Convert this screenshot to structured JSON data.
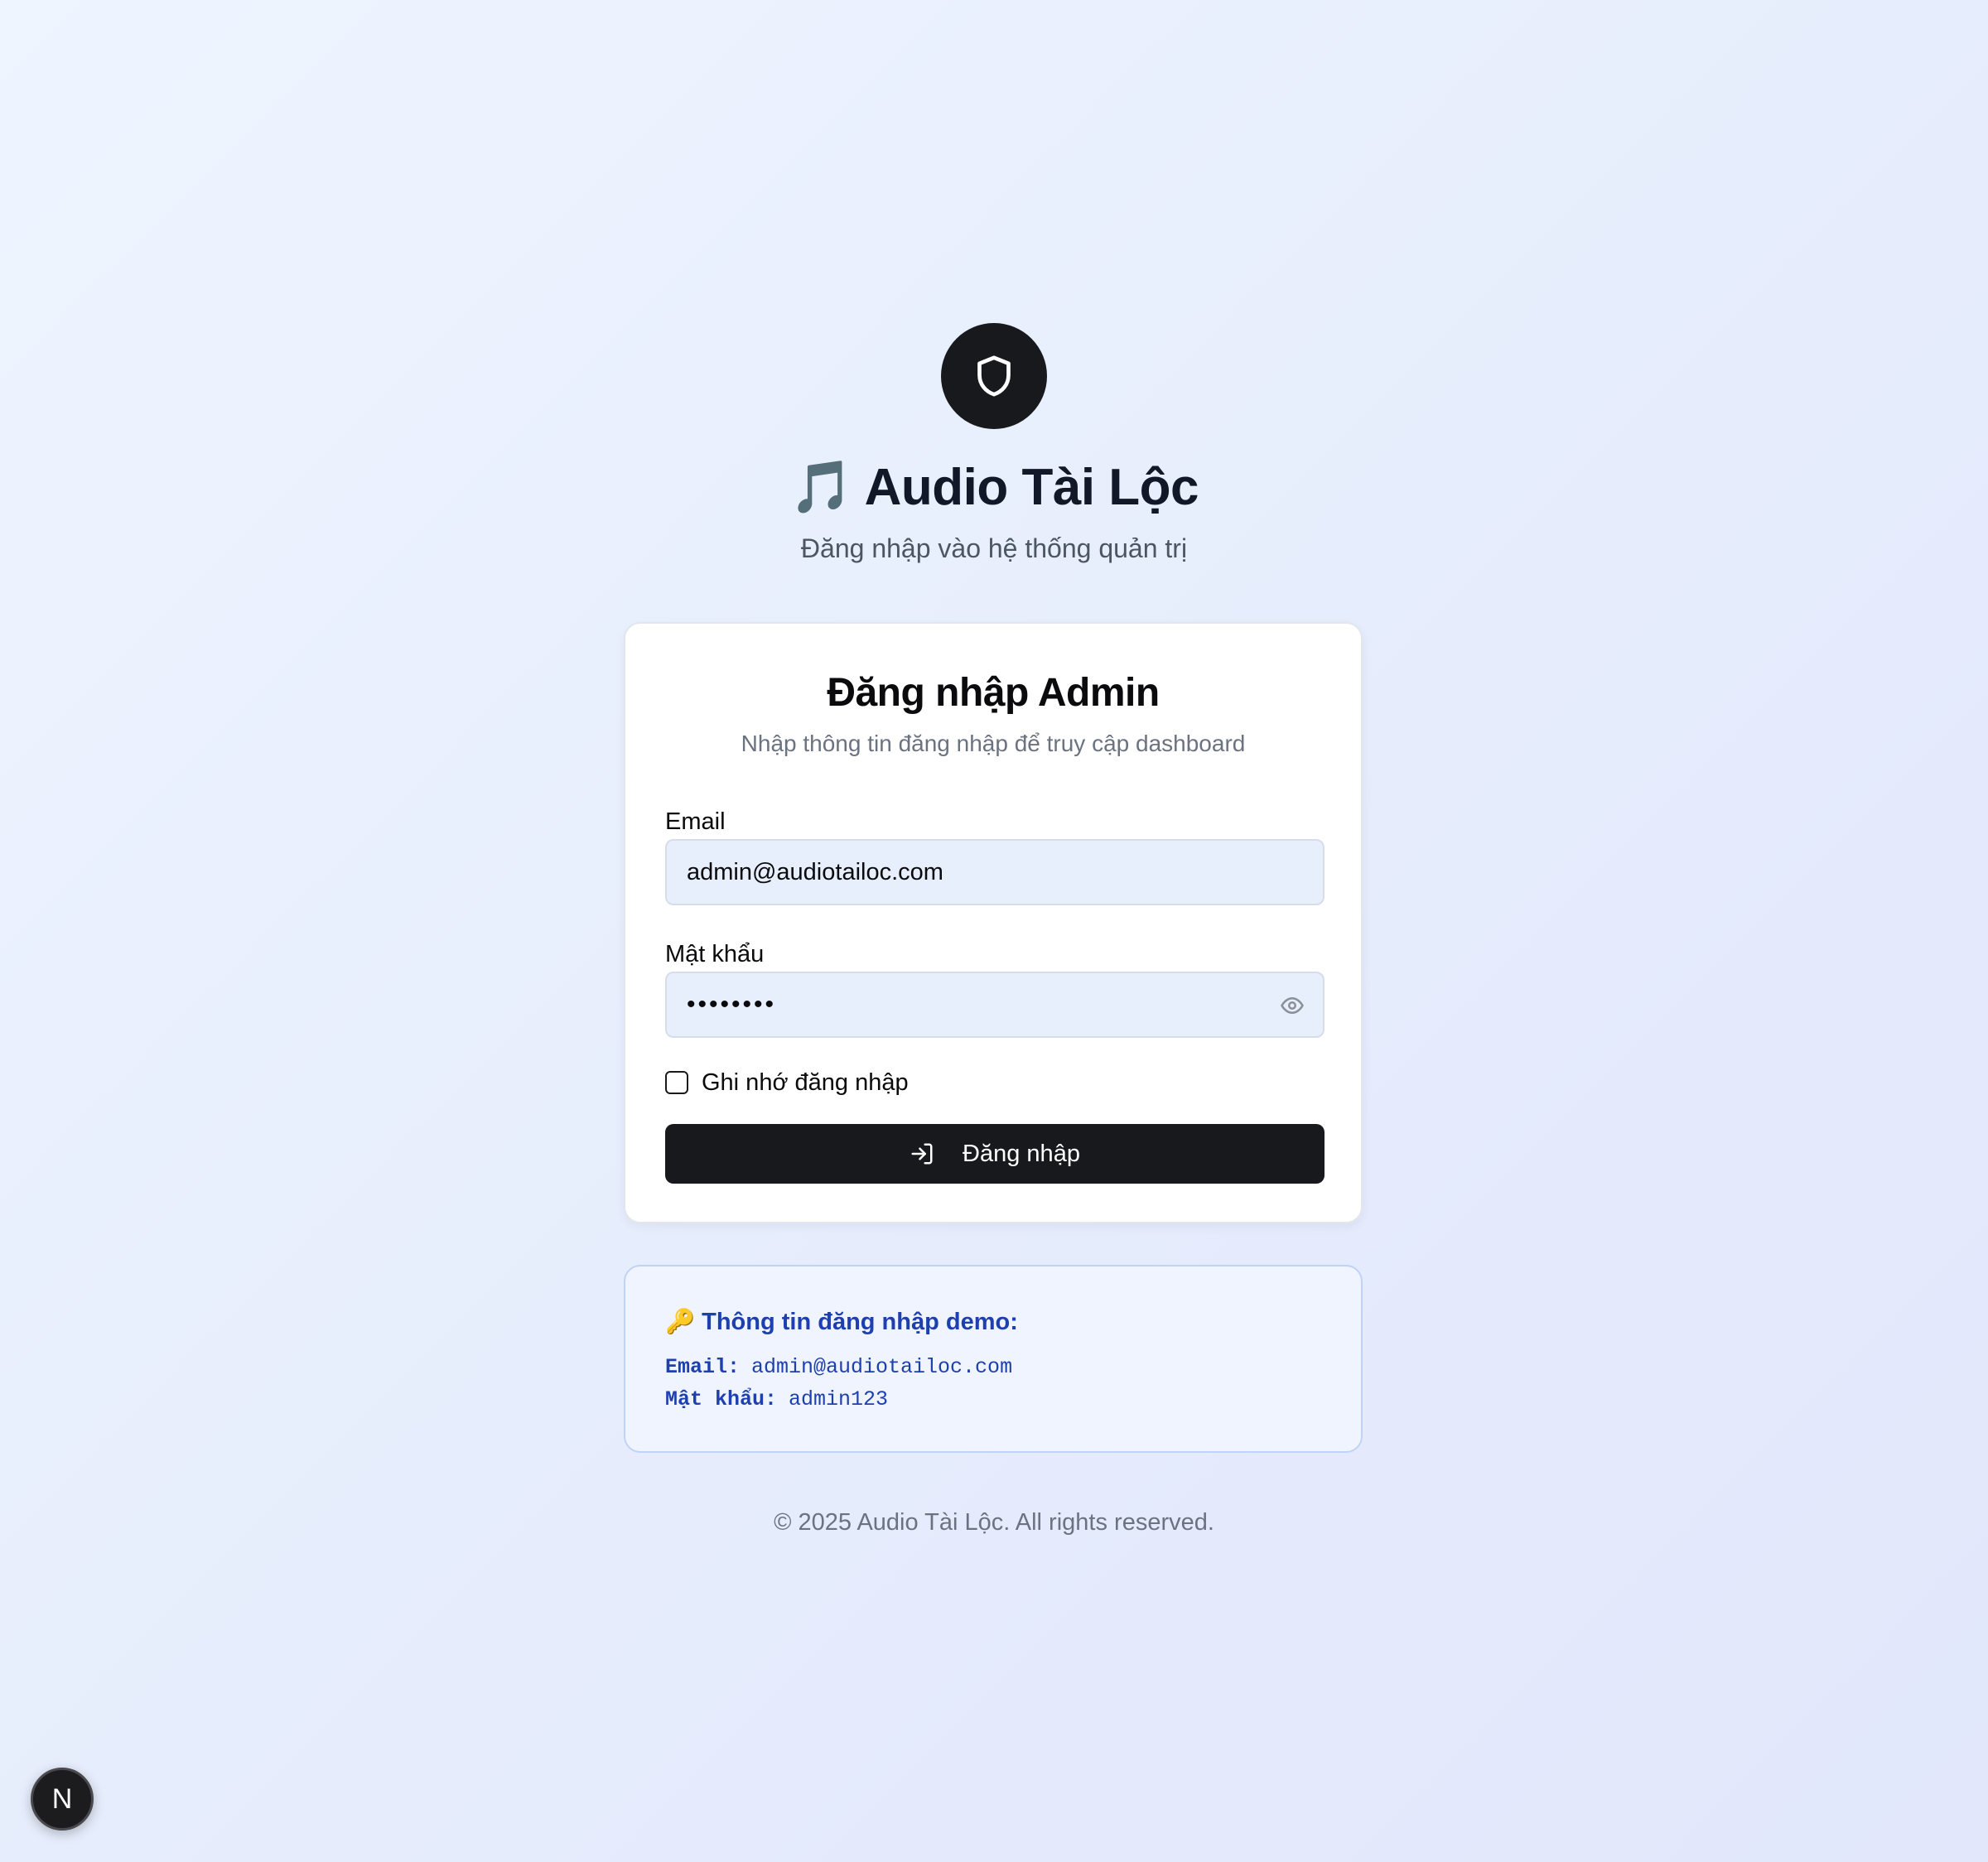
{
  "brand": {
    "logo_icon": "shield-icon",
    "title_emoji": "🎵",
    "title": "Audio Tài Lộc",
    "subtitle": "Đăng nhập vào hệ thống quản trị"
  },
  "login_card": {
    "title": "Đăng nhập Admin",
    "description": "Nhập thông tin đăng nhập để truy cập dashboard",
    "email": {
      "label": "Email",
      "value": "admin@audiotailoc.com"
    },
    "password": {
      "label": "Mật khẩu",
      "value_masked": "••••••••",
      "toggle_icon": "eye-icon"
    },
    "remember": {
      "label": "Ghi nhớ đăng nhập",
      "checked": false
    },
    "submit": {
      "label": "Đăng nhập",
      "icon": "log-in-icon"
    }
  },
  "demo": {
    "icon_emoji": "🔑",
    "title": "Thông tin đăng nhập demo:",
    "email_key": "Email:",
    "email_value": "admin@audiotailoc.com",
    "password_key": "Mật khẩu:",
    "password_value": "admin123"
  },
  "footer": {
    "text": "© 2025 Audio Tài Lộc. All rights reserved."
  },
  "dev_badge": {
    "letter": "N"
  },
  "colors": {
    "primary_dark": "#18191c",
    "demo_text": "#1e40af",
    "demo_bg": "#eff4ff",
    "input_bg": "#e7eefc",
    "muted_text": "#6b7280"
  }
}
